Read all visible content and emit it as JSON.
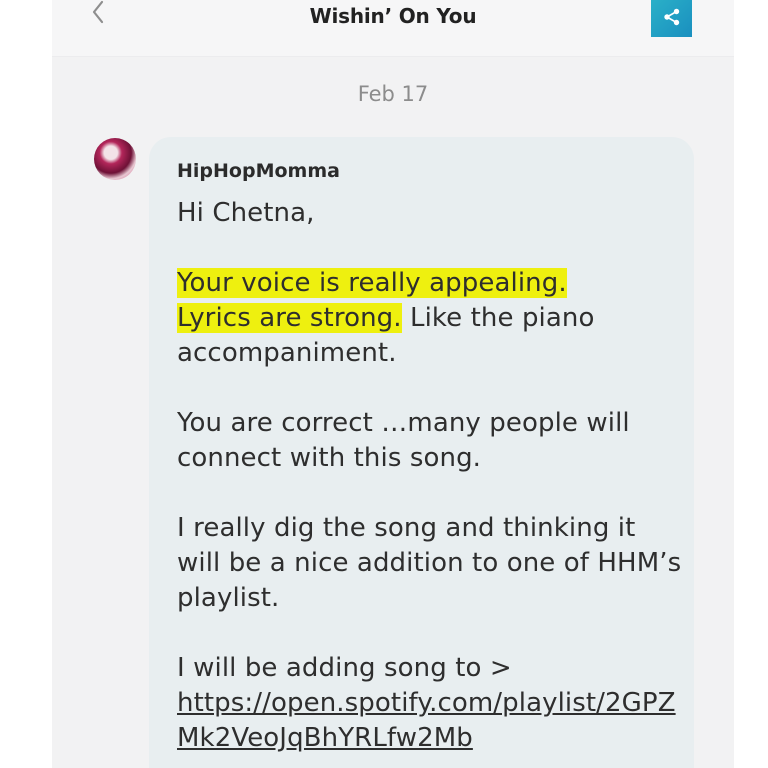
{
  "header": {
    "title": "Wishin’ On You"
  },
  "thread": {
    "date": "Feb 17"
  },
  "message": {
    "sender": "HipHopMomma",
    "greeting": "Hi Chetna,",
    "highlight1": "Your voice is really appealing.",
    "highlight2": "Lyrics are strong.",
    "p1_rest": " Like the piano accompaniment.",
    "p2": "You are correct …many people will connect with this song.",
    "p3": "I really dig the song and thinking it will be a nice addition to one of HHM’s playlist.",
    "p4": "I will be adding song to >",
    "link": "https://open.spotify.com/playlist/2GPZMk2VeoJqBhYRLfw2Mb"
  },
  "colors": {
    "highlight": "#eef00f",
    "share_button": "#2ab0c8",
    "bubble": "#e8eef0"
  },
  "icons": {
    "back": "chevron-left-icon",
    "share": "share-icon"
  }
}
